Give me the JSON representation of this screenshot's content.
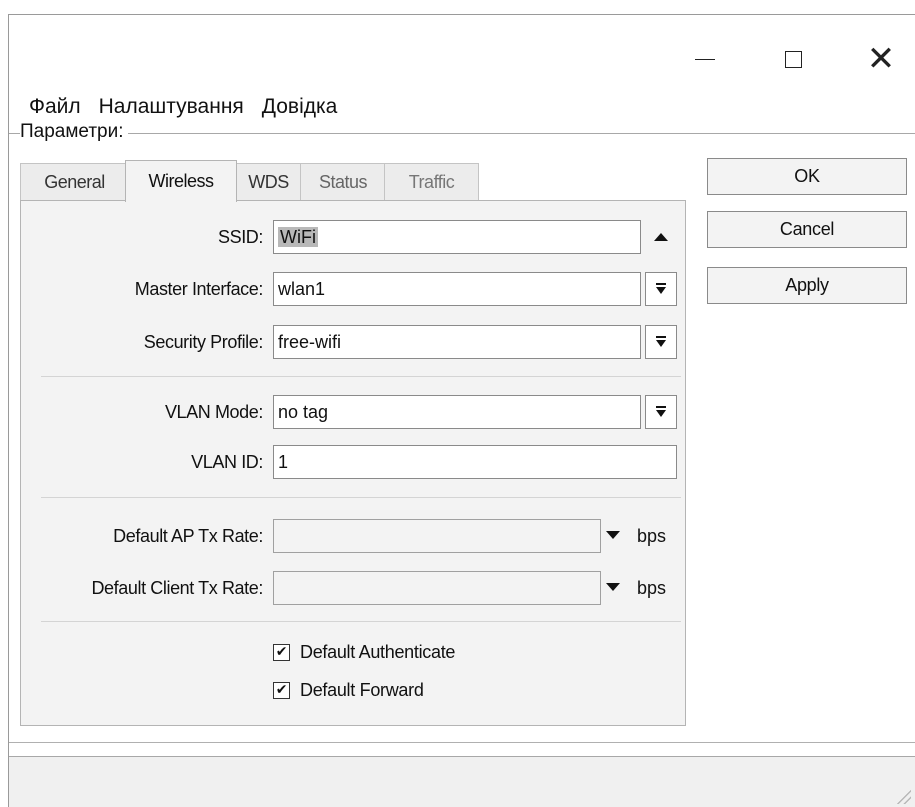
{
  "window": {
    "minimize_icon": "minimize-icon",
    "maximize_icon": "maximize-icon",
    "close_glyph": "✕"
  },
  "menu": [
    "Файл",
    "Налаштування",
    "Довідка"
  ],
  "params_label": "Параметри:",
  "tabs": [
    {
      "label": "General",
      "active": false
    },
    {
      "label": "Wireless",
      "active": true
    },
    {
      "label": "WDS",
      "active": false
    },
    {
      "label": "Status",
      "active": false
    },
    {
      "label": "Traffic",
      "active": false
    }
  ],
  "form": {
    "ssid": {
      "label": "SSID:",
      "value": "WiFi"
    },
    "master_interface": {
      "label": "Master Interface:",
      "value": "wlan1"
    },
    "security_profile": {
      "label": "Security Profile:",
      "value": "free-wifi"
    },
    "vlan_mode": {
      "label": "VLAN Mode:",
      "value": "no tag"
    },
    "vlan_id": {
      "label": "VLAN ID:",
      "value": "1"
    },
    "default_ap_tx_rate": {
      "label": "Default AP Tx Rate:",
      "value": "",
      "unit": "bps"
    },
    "default_client_tx_rate": {
      "label": "Default Client Tx Rate:",
      "value": "",
      "unit": "bps"
    },
    "default_authenticate": {
      "label": "Default Authenticate",
      "checked": true
    },
    "default_forward": {
      "label": "Default Forward",
      "checked": true
    }
  },
  "buttons": {
    "ok": "OK",
    "cancel": "Cancel",
    "apply": "Apply"
  },
  "checkmark": "✔"
}
